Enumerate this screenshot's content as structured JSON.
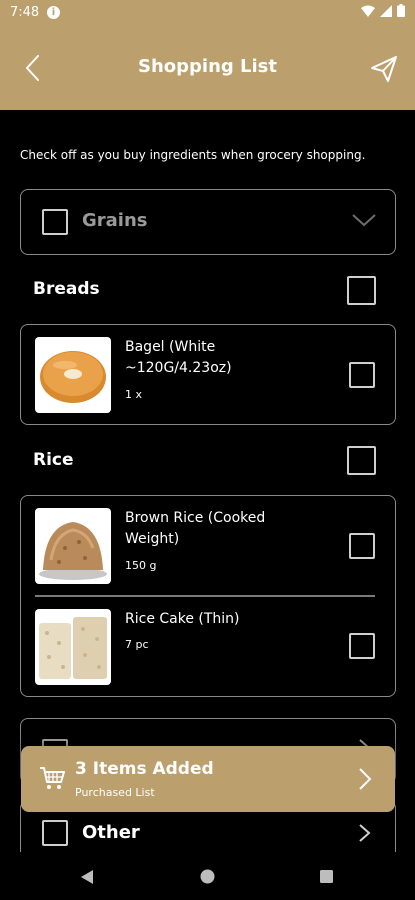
{
  "status": {
    "time": "7:48",
    "info_glyph": "i"
  },
  "header": {
    "title": "Shopping List"
  },
  "instruction": "Check off as you buy ingredients when grocery shopping.",
  "category_grains": {
    "label": "Grains"
  },
  "sections": [
    {
      "title": "Breads",
      "items": [
        {
          "name": "Bagel (White ~120G/4.23oz)",
          "qty": "1 x"
        }
      ]
    },
    {
      "title": "Rice",
      "items": [
        {
          "name": "Brown Rice (Cooked Weight)",
          "qty": "150 g"
        },
        {
          "name": "Rice Cake (Thin)",
          "qty": "7 pc"
        }
      ]
    }
  ],
  "category_other": {
    "label": "Other"
  },
  "purchase_bar": {
    "title": "3 Items Added",
    "subtitle": "Purchased List"
  },
  "colors": {
    "accent": "#bb9f6d",
    "background": "#000000",
    "border": "#8a8a8a"
  }
}
